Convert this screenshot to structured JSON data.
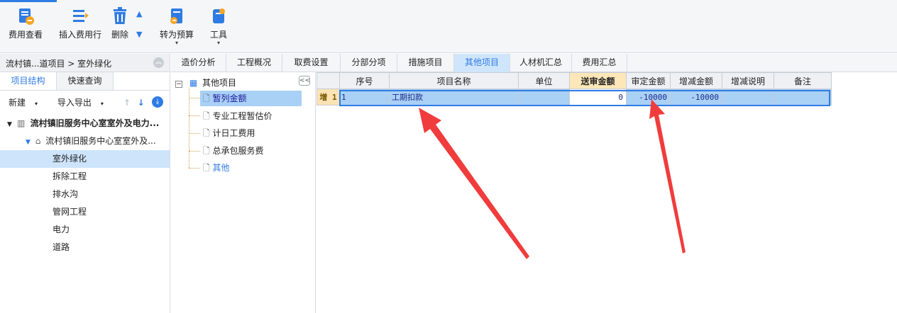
{
  "toolbar": {
    "fee_view": "费用查看",
    "insert_fee_row": "插入费用行",
    "delete": "删除",
    "to_budget": "转为预算",
    "tools": "工具"
  },
  "breadcrumb": "流村镇...道项目 > 室外绿化",
  "left_panel": {
    "tabs": [
      "项目结构",
      "快速查询"
    ],
    "new_label": "新建",
    "import_export_label": "导入导出",
    "tree": {
      "root": "流村镇旧服务中心室室外及电力...",
      "child": "流村镇旧服务中心室室外及...",
      "items": [
        "室外绿化",
        "拆除工程",
        "排水沟",
        "管网工程",
        "电力",
        "道路"
      ]
    }
  },
  "main_tabs": [
    "造价分析",
    "工程概况",
    "取费设置",
    "分部分项",
    "措施项目",
    "其他项目",
    "人材机汇总",
    "费用汇总"
  ],
  "mid_tree": {
    "root": "其他项目",
    "items": [
      "暂列金额",
      "专业工程暂估价",
      "计日工费用",
      "总承包服务费",
      "其他"
    ]
  },
  "grid": {
    "headers": [
      "序号",
      "项目名称",
      "单位",
      "送审金额",
      "审定金额",
      "增减金额",
      "增减说明",
      "备注"
    ],
    "row": {
      "row_header": "增 1",
      "seq": "1",
      "name": "工期扣款",
      "unit": "",
      "submitted": "0",
      "approved": "-10000",
      "diff": "-10000",
      "diff_note": "",
      "remark": ""
    }
  },
  "colors": {
    "accent": "#2f7be4",
    "selection": "#a9d0f5",
    "annotation": "#f03c3c"
  }
}
